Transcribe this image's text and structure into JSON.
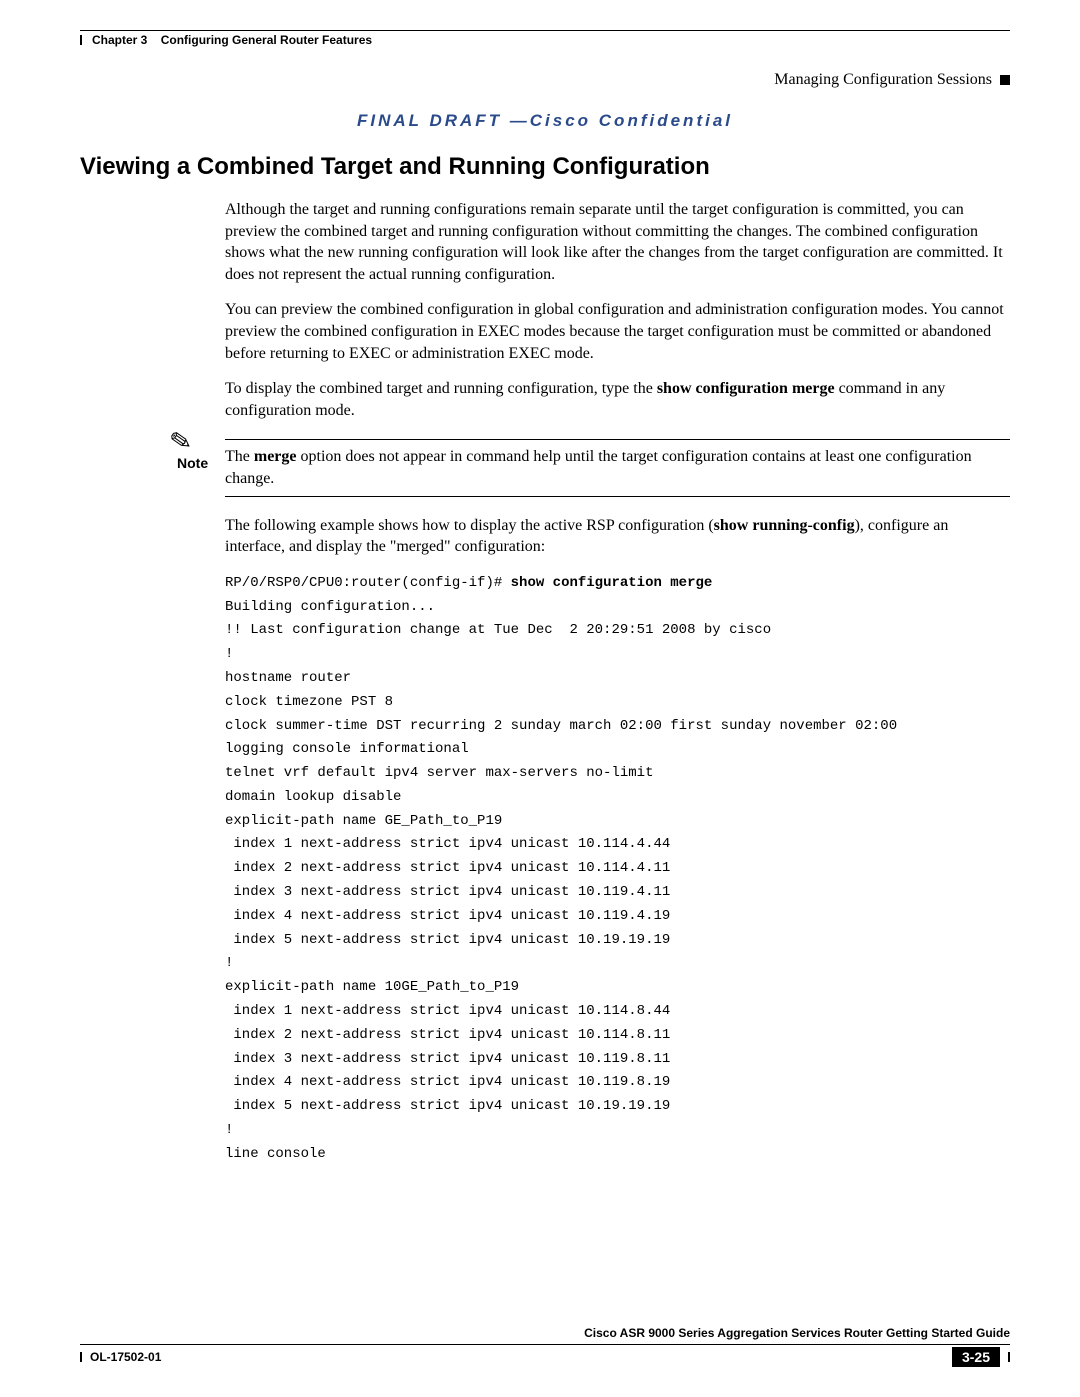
{
  "header": {
    "chapter": "Chapter 3",
    "chapter_title": "Configuring General Router Features",
    "section": "Managing Configuration Sessions"
  },
  "banner": "FINAL DRAFT —Cisco Confidential",
  "heading": "Viewing a Combined Target and Running Configuration",
  "p1": "Although the target and running configurations remain separate until the target configuration is committed, you can preview the combined target and running configuration without committing the changes. The combined configuration shows what the new running configuration will look like after the changes from the target configuration are committed. It does not represent the actual running configuration.",
  "p2": "You can preview the combined configuration in global configuration and administration configuration modes. You cannot preview the combined configuration in EXEC modes because the target configuration must be committed or abandoned before returning to EXEC or administration EXEC mode.",
  "p3a": "To display the combined target and running configuration, type the ",
  "p3b": "show configuration merge",
  "p3c": " command in any configuration mode.",
  "note_label": "Note",
  "note_a": "The ",
  "note_b": "merge",
  "note_c": " option does not appear in command help until the target configuration contains at least one configuration change.",
  "p4a": "The following example shows how to display the active RSP configuration (",
  "p4b": "show running-config",
  "p4c": "), configure an interface, and display the \"merged\" configuration:",
  "code": {
    "prompt": "RP/0/RSP0/CPU0:router(config-if)# ",
    "cmd": "show configuration merge",
    "lines": [
      "Building configuration...",
      "!! Last configuration change at Tue Dec  2 20:29:51 2008 by cisco",
      "!",
      "hostname router",
      "clock timezone PST 8",
      "clock summer-time DST recurring 2 sunday march 02:00 first sunday november 02:00",
      "logging console informational",
      "telnet vrf default ipv4 server max-servers no-limit",
      "domain lookup disable",
      "explicit-path name GE_Path_to_P19",
      " index 1 next-address strict ipv4 unicast 10.114.4.44",
      " index 2 next-address strict ipv4 unicast 10.114.4.11",
      " index 3 next-address strict ipv4 unicast 10.119.4.11",
      " index 4 next-address strict ipv4 unicast 10.119.4.19",
      " index 5 next-address strict ipv4 unicast 10.19.19.19",
      "!",
      "explicit-path name 10GE_Path_to_P19",
      " index 1 next-address strict ipv4 unicast 10.114.8.44",
      " index 2 next-address strict ipv4 unicast 10.114.8.11",
      " index 3 next-address strict ipv4 unicast 10.119.8.11",
      " index 4 next-address strict ipv4 unicast 10.119.8.19",
      " index 5 next-address strict ipv4 unicast 10.19.19.19",
      "!",
      "line console"
    ]
  },
  "footer": {
    "book": "Cisco ASR 9000 Series Aggregation Services Router Getting Started Guide",
    "docid": "OL-17502-01",
    "page": "3-25"
  }
}
